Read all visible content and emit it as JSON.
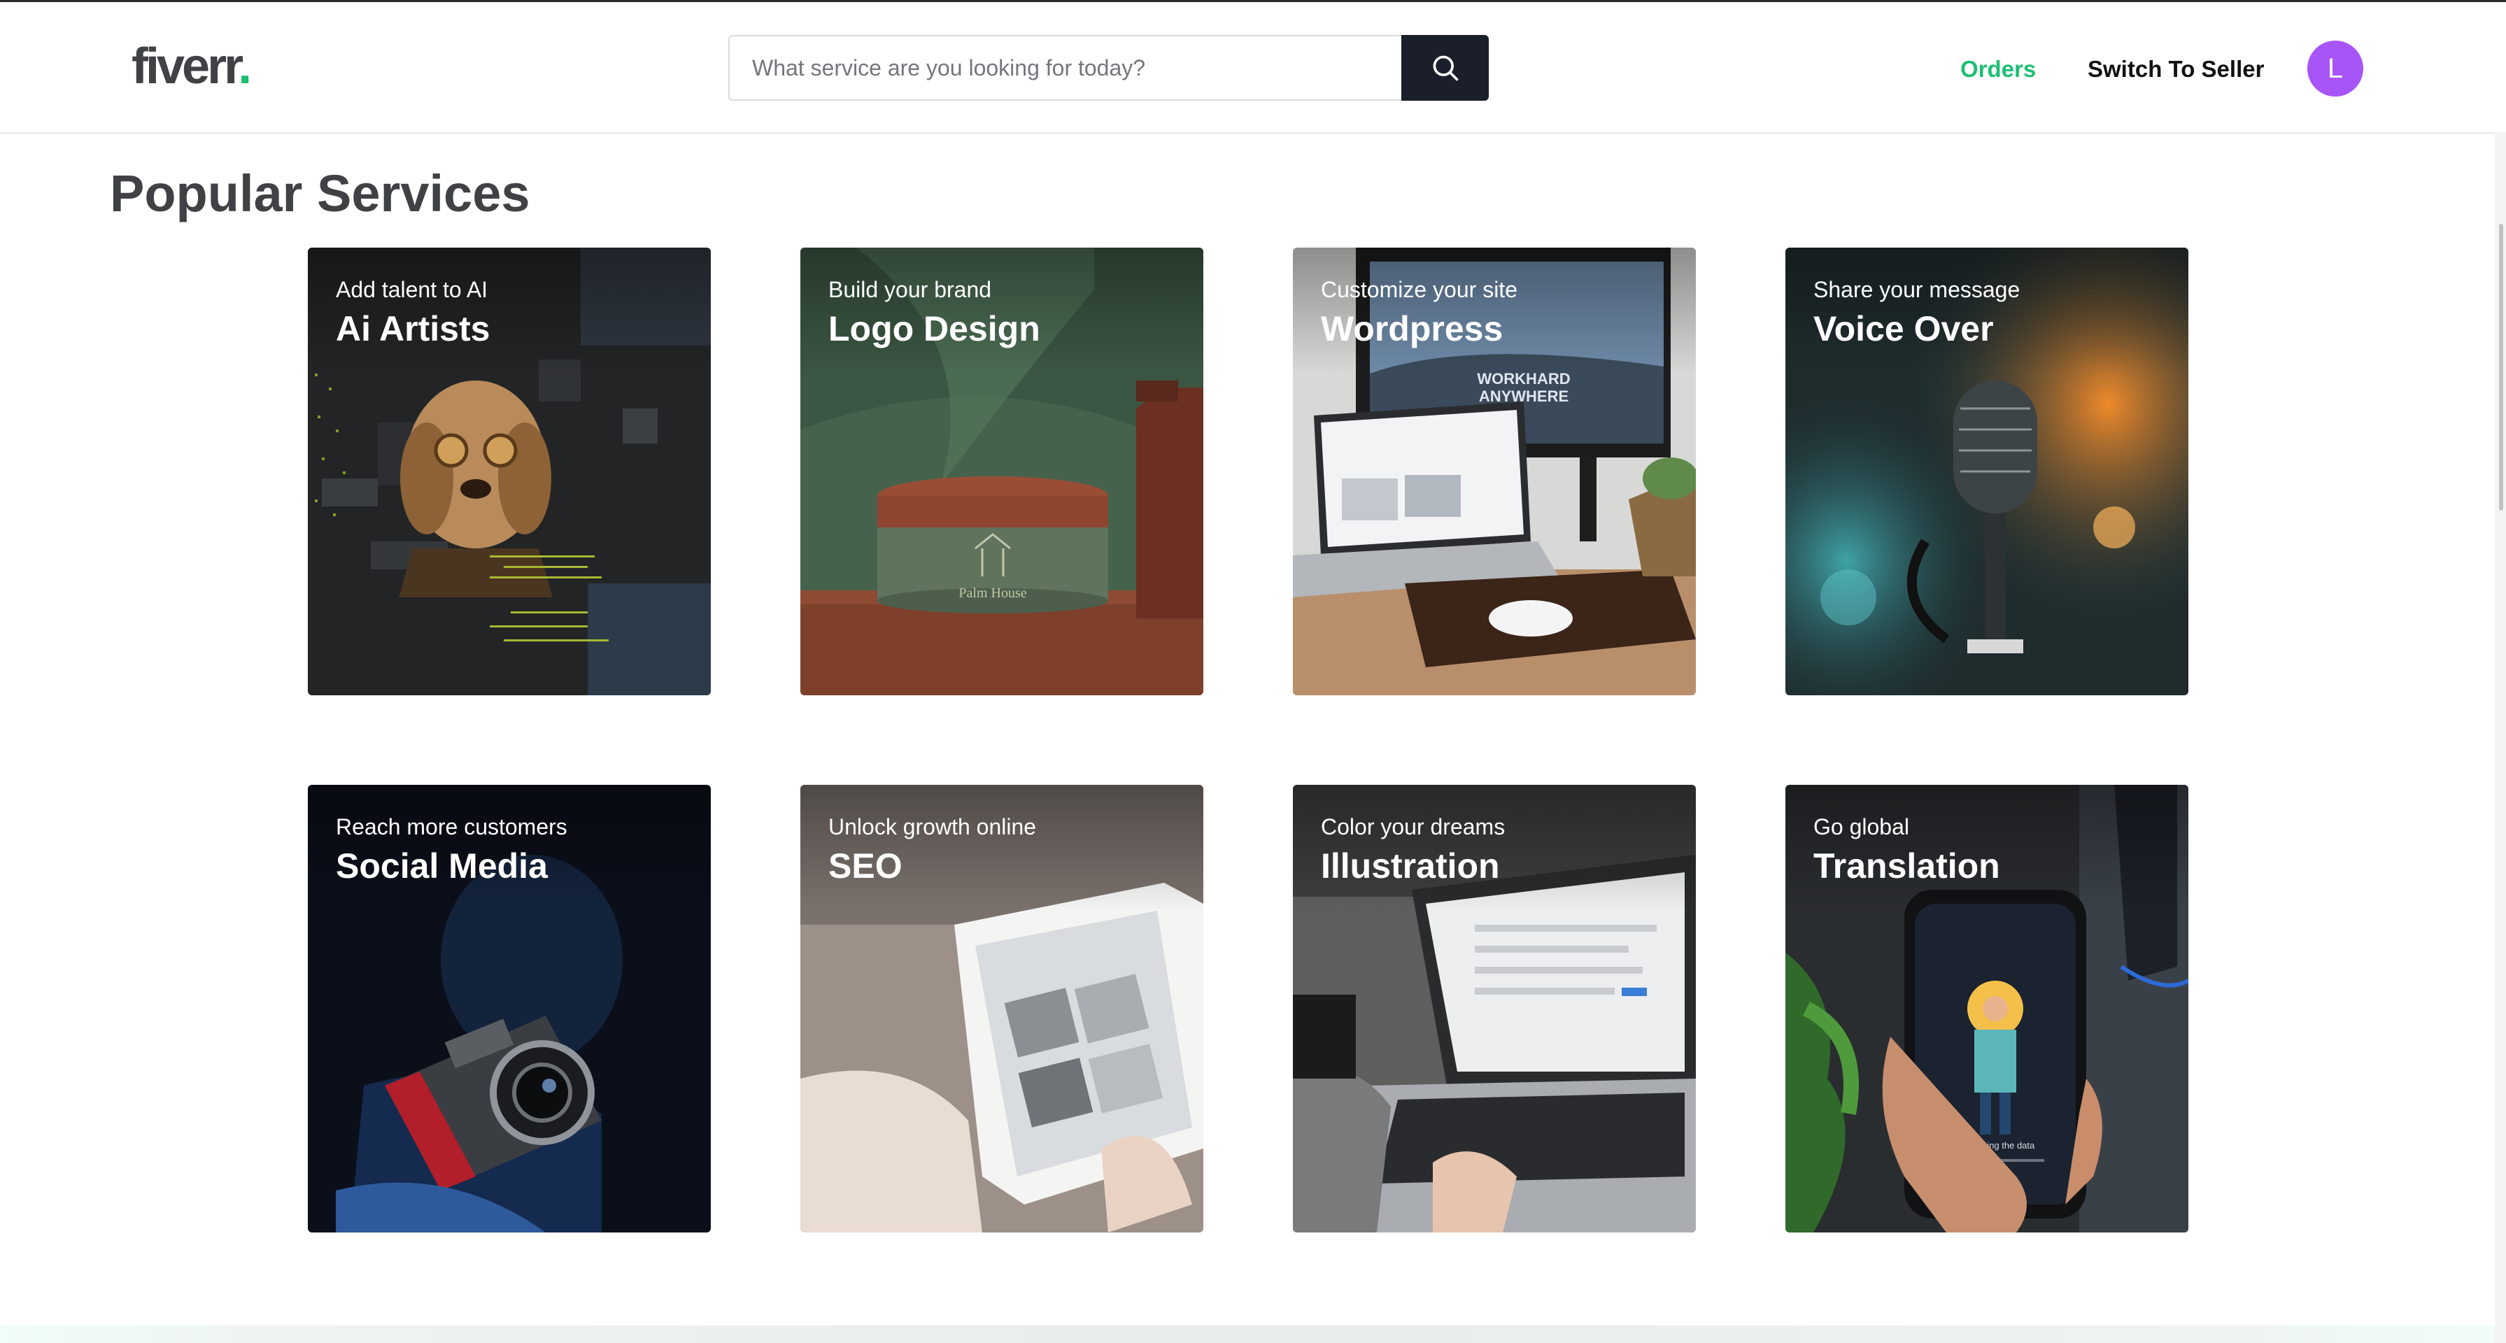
{
  "header": {
    "logo_text": "fiverr",
    "logo_dot": ".",
    "search_placeholder": "What service are you looking for today?",
    "nav_orders": "Orders",
    "nav_switch": "Switch To Seller",
    "avatar_initial": "L"
  },
  "section": {
    "title": "Popular Services"
  },
  "cards": [
    {
      "subtitle": "Add talent to AI",
      "title": "Ai Artists"
    },
    {
      "subtitle": "Build your brand",
      "title": "Logo Design"
    },
    {
      "subtitle": "Customize your site",
      "title": "Wordpress"
    },
    {
      "subtitle": "Share your message",
      "title": "Voice Over"
    },
    {
      "subtitle": "Reach more customers",
      "title": "Social Media"
    },
    {
      "subtitle": "Unlock growth online",
      "title": "SEO"
    },
    {
      "subtitle": "Color your dreams",
      "title": "Illustration"
    },
    {
      "subtitle": "Go global",
      "title": "Translation"
    }
  ],
  "colors": {
    "brand_green": "#1dbf73",
    "avatar_purple": "#a855f7",
    "search_button": "#1a1f2b",
    "text_dark": "#404145"
  }
}
